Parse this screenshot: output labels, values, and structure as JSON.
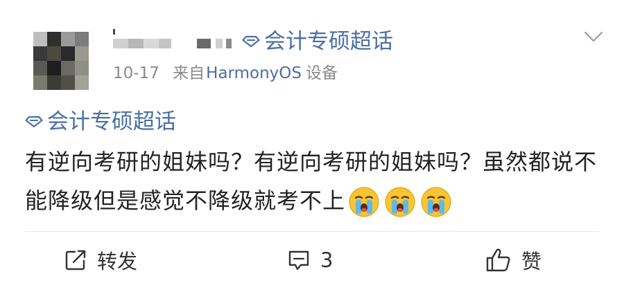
{
  "post": {
    "username": "",
    "header_topic": "会计专硕超话",
    "meta": {
      "date": "10-17",
      "source_prefix": "来自",
      "source_device": "HarmonyOS",
      "source_suffix": "设备"
    },
    "topic": "会计专硕超话",
    "text": "有逆向考研的姐妹吗？有逆向考研的姐妹吗？虽然都说不能降级但是感觉不降级就考不上",
    "emojis": [
      "crying-emoji",
      "crying-emoji",
      "crying-emoji"
    ]
  },
  "actions": {
    "repost_label": "转发",
    "comment_count": "3",
    "like_label": "赞"
  },
  "colors": {
    "link": "#4a6fa5",
    "meta": "#8a8a8a",
    "text": "#222222",
    "emoji_face": "#f7c531"
  },
  "icons": [
    "chevron-down-icon",
    "super-topic-icon",
    "repost-icon",
    "comment-icon",
    "like-icon"
  ]
}
